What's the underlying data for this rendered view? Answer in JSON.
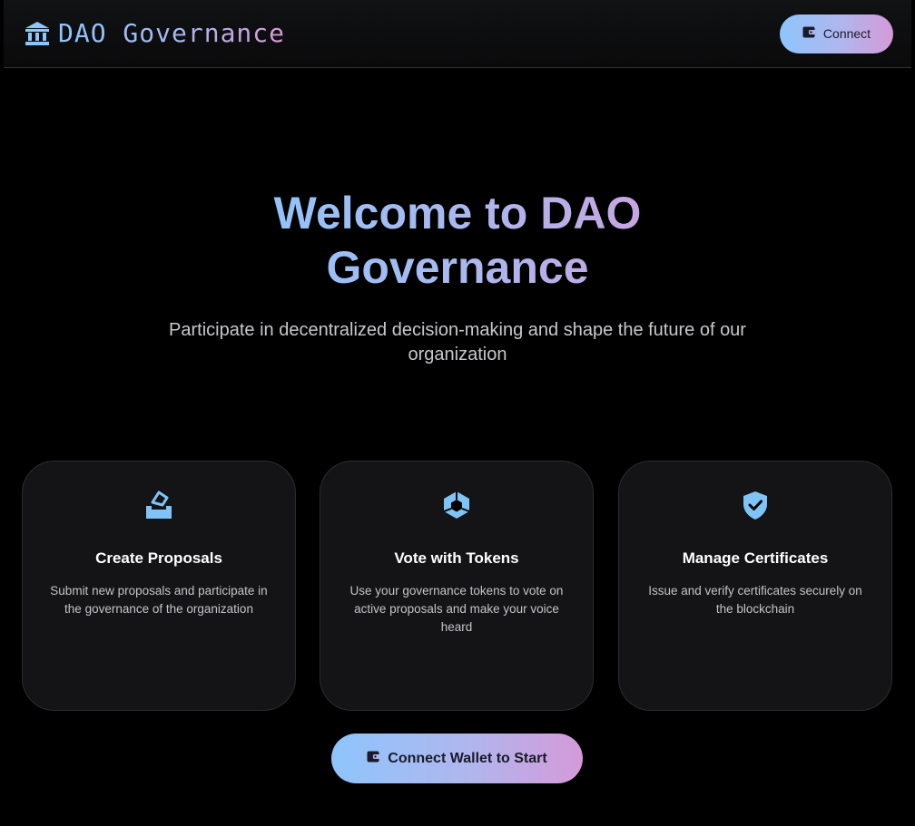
{
  "header": {
    "brand_title": "DAO Governance",
    "brand_icon": "bank-icon",
    "connect_label": "Connect",
    "connect_icon": "wallet-icon"
  },
  "hero": {
    "title": "Welcome to DAO Governance",
    "subtitle": "Participate in decentralized decision-making and shape the future of our organization"
  },
  "features": [
    {
      "icon": "ballot-box-icon",
      "title": "Create Proposals",
      "description": "Submit new proposals and participate in the governance of the organization"
    },
    {
      "icon": "token-cube-icon",
      "title": "Vote with Tokens",
      "description": "Use your governance tokens to vote on active proposals and make your voice heard"
    },
    {
      "icon": "shield-check-icon",
      "title": "Manage Certificates",
      "description": "Issue and verify certificates securely on the blockchain"
    }
  ],
  "cta": {
    "label": "Connect Wallet to Start",
    "icon": "wallet-icon"
  },
  "colors": {
    "background": "#000000",
    "accent_start": "#8ec5fc",
    "accent_end": "#d59ad8",
    "card_background": "#141416",
    "icon_blue": "#7fc4f7"
  }
}
